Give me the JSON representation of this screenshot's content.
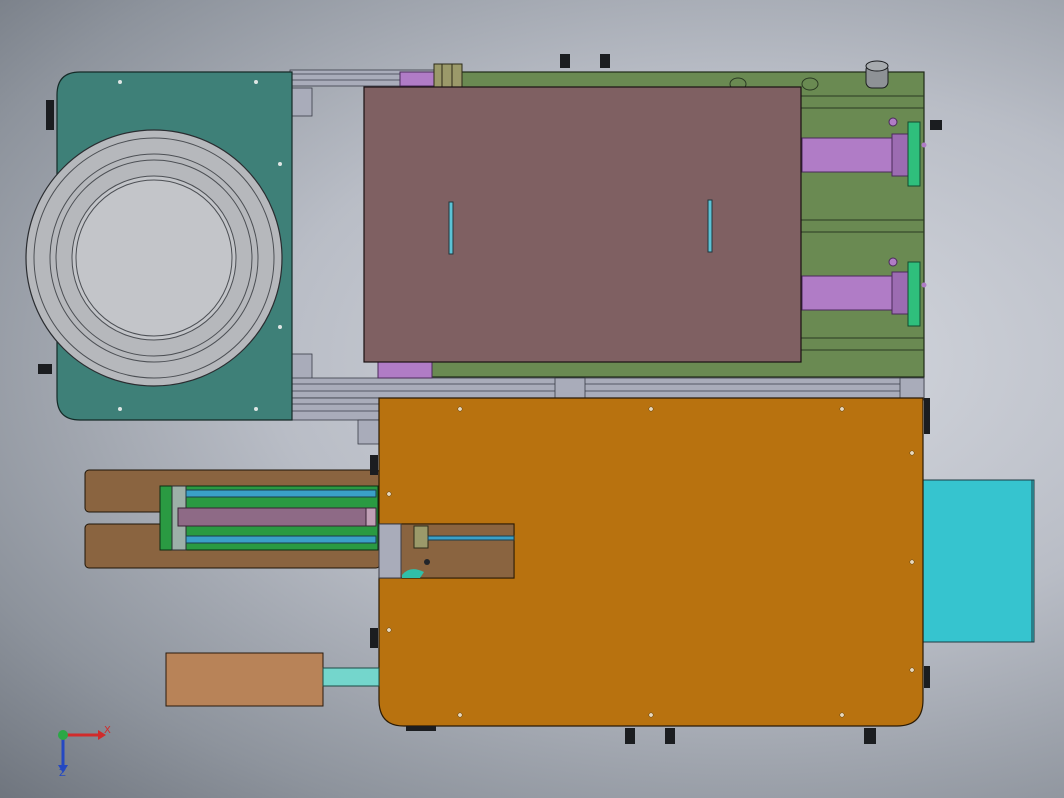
{
  "viewport": {
    "background_center": "#d6d9e0",
    "background_edge": "#6f757e"
  },
  "colors": {
    "teal_plate": "#3e8078",
    "disc_outer": "#b6b8bc",
    "disc_inner": "#c3c5c9",
    "olive_frame": "#6a8a52",
    "mauve_plate": "#7f6062",
    "purple_cylinder": "#b07cc6",
    "green_bracket": "#2fbf7c",
    "rail_gray": "#a9acba",
    "orange_plate": "#b8720f",
    "brown_plate": "#8a6440",
    "cyan_block": "#36c4cf",
    "tan_block": "#b88358",
    "light_cyan_rod": "#74d6cc",
    "green_rail": "#2a9a42",
    "blue_rod": "#3aa0c8"
  },
  "triad": {
    "x_label": "X",
    "z_label": "Z",
    "x_color": "#d12b2b",
    "z_color": "#2448c2",
    "origin_color": "#2aa845"
  }
}
